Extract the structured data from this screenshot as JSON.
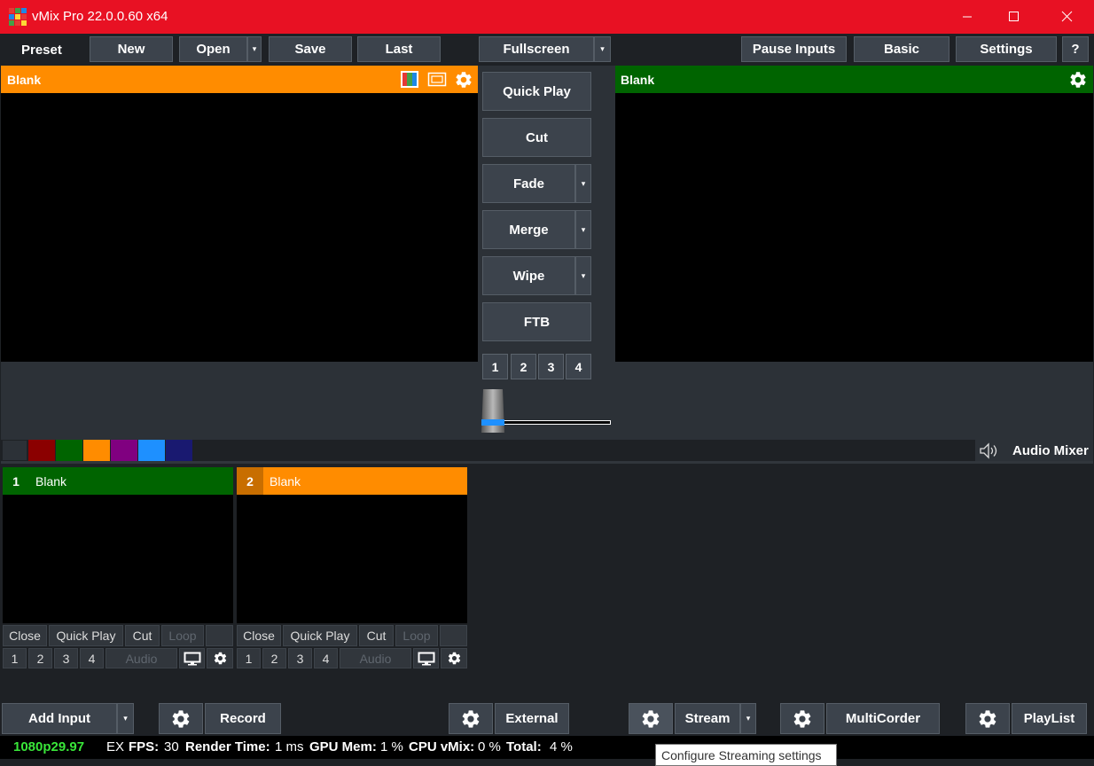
{
  "window": {
    "title": "vMix Pro 22.0.0.60 x64",
    "titlebar_color": "#e81123"
  },
  "toolbar": {
    "preset": "Preset",
    "new": "New",
    "open": "Open",
    "save": "Save",
    "last": "Last",
    "fullscreen": "Fullscreen",
    "pause_inputs": "Pause Inputs",
    "basic": "Basic",
    "settings": "Settings",
    "help": "?"
  },
  "preview": {
    "title": "Blank",
    "color": "#ff8c00"
  },
  "output": {
    "title": "Blank",
    "color": "#006400"
  },
  "transitions": {
    "quick_play": "Quick Play",
    "cut": "Cut",
    "fade": "Fade",
    "merge": "Merge",
    "wipe": "Wipe",
    "ftb": "FTB",
    "numbers": [
      "1",
      "2",
      "3",
      "4"
    ]
  },
  "color_tags": [
    "#2c3137",
    "#8b0000",
    "#006400",
    "#ff8c00",
    "#800080",
    "#1e90ff",
    "#191970"
  ],
  "audio_mixer": "Audio Mixer",
  "inputs": [
    {
      "number": "1",
      "name": "Blank",
      "color": "#006400",
      "num_bg": "#006400",
      "close": "Close",
      "quick_play": "Quick Play",
      "cut": "Cut",
      "loop": "Loop",
      "overlays": [
        "1",
        "2",
        "3",
        "4"
      ],
      "audio": "Audio"
    },
    {
      "number": "2",
      "name": "Blank",
      "color": "#ff8c00",
      "num_bg": "#c86e00",
      "close": "Close",
      "quick_play": "Quick Play",
      "cut": "Cut",
      "loop": "Loop",
      "overlays": [
        "1",
        "2",
        "3",
        "4"
      ],
      "audio": "Audio"
    }
  ],
  "bottom": {
    "add_input": "Add Input",
    "record": "Record",
    "external": "External",
    "stream": "Stream",
    "multicorder": "MultiCorder",
    "playlist": "PlayList"
  },
  "status": {
    "format": "1080p29.97",
    "ex": "EX",
    "fps_label": "FPS:",
    "fps": "30",
    "render_label": "Render Time:",
    "render": "1 ms",
    "gpu_label": "GPU Mem:",
    "gpu": "1 %",
    "cpu_label": "CPU vMix:",
    "cpu": "0 %",
    "total_label": "Total:",
    "total": "4 %"
  },
  "tooltip": "Configure Streaming settings",
  "icons": {
    "app": "vmix-logo-icon",
    "gear": "gear-icon",
    "speaker": "speaker-icon",
    "monitor": "monitor-icon"
  }
}
